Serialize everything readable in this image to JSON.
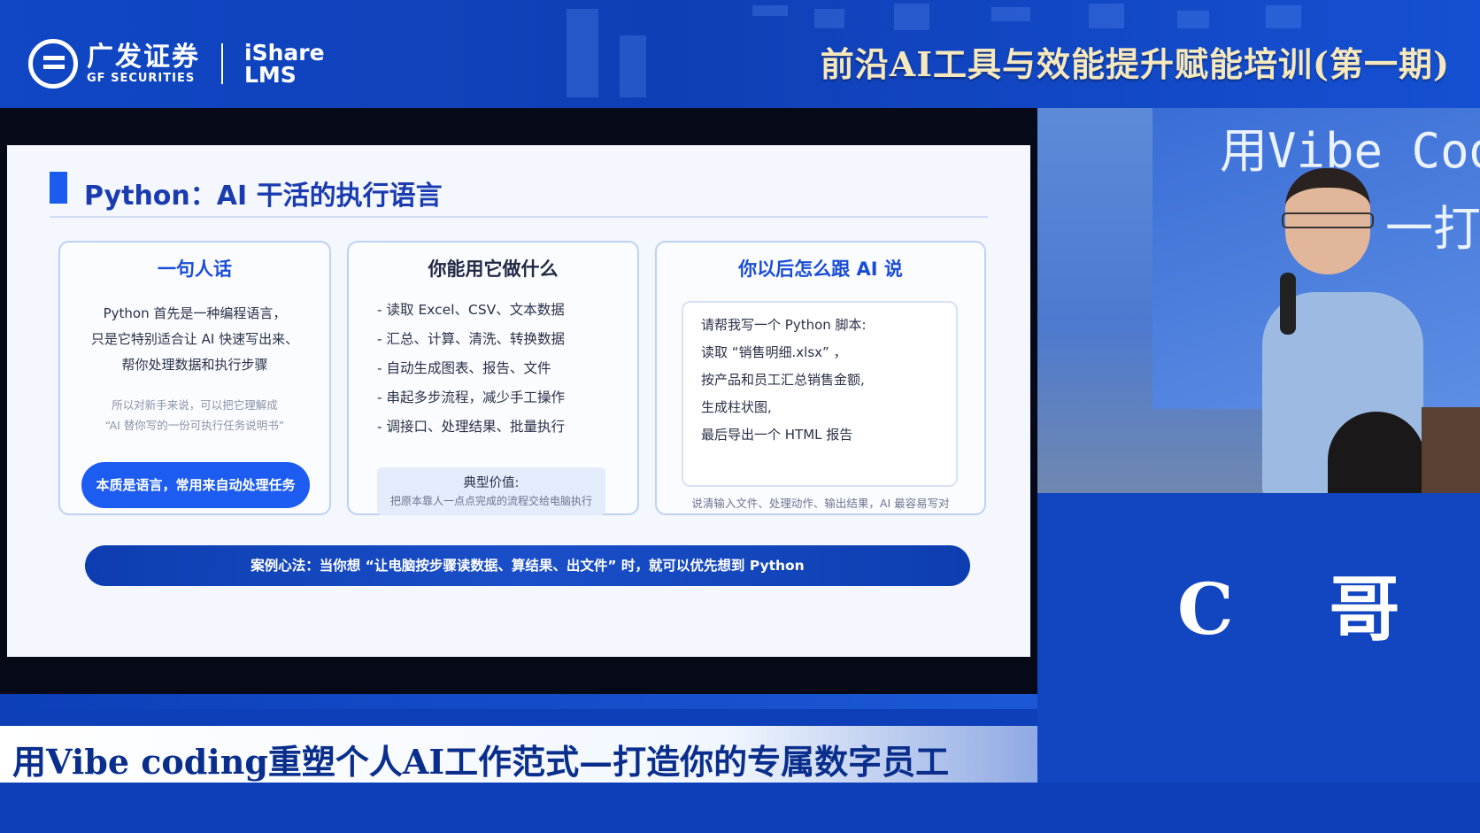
{
  "header": {
    "brand_cn": "广发证券",
    "brand_en": "GF SECURITIES",
    "lms_line1": "iShare",
    "lms_line2": "LMS",
    "event_title": "前沿AI工具与效能提升赋能培训(第一期)"
  },
  "slide": {
    "title": "Python：AI 干活的执行语言",
    "card1": {
      "heading": "一句人话",
      "body": [
        "Python 首先是一种编程语言，",
        "只是它特别适合让 AI 快速写出来、",
        "帮你处理数据和执行步骤"
      ],
      "note": [
        "所以对新手来说，可以把它理解成",
        "“AI 替你写的一份可执行任务说明书”"
      ],
      "pill": "本质是语言，常用来自动处理任务"
    },
    "card2": {
      "heading": "你能用它做什么",
      "items": [
        "- 读取 Excel、CSV、文本数据",
        "- 汇总、计算、清洗、转换数据",
        "- 自动生成图表、报告、文件",
        "- 串起多步流程，减少手工操作",
        "- 调接口、处理结果、批量执行"
      ],
      "value_title": "典型价值:",
      "value_desc": "把原本靠人一点点完成的流程交给电脑执行"
    },
    "card3": {
      "heading": "你以后怎么跟 AI 说",
      "prompt": [
        "请帮我写一个 Python 脚本:",
        "读取 “销售明细.xlsx” ，",
        "按产品和员工汇总销售金额,",
        "生成柱状图,",
        "最后导出一个 HTML 报告"
      ],
      "footer": "说清输入文件、处理动作、输出结果，AI 最容易写对"
    },
    "banner": "案例心法：当你想 “让电脑按步骤读数据、算结果、出文件” 时，就可以优先想到 Python"
  },
  "video": {
    "screen_text_line1": "用Vibe Codi",
    "screen_text_line2": "一打造"
  },
  "speaker": {
    "name": "C 哥"
  },
  "caption": {
    "text": "用Vibe coding重塑个人AI工作范式—打造你的专属数字员工"
  },
  "colors": {
    "accent": "#1d5cf0",
    "header_bg": "#0f3fb6",
    "title_gold": "#f6e8bd",
    "caption_text": "#0a2e8c"
  }
}
